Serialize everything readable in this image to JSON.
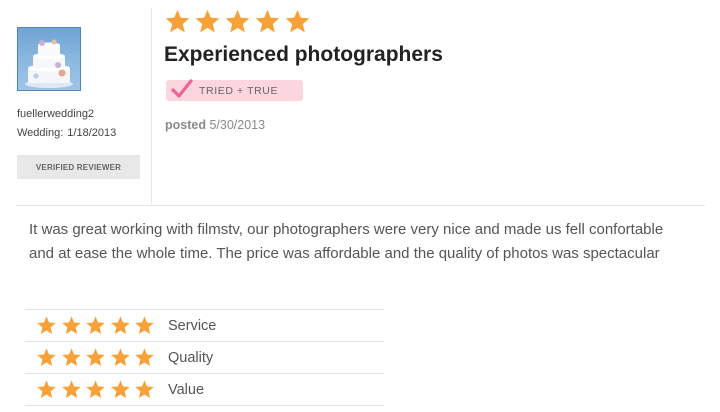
{
  "reviewer": {
    "username": "fuellerwedding2",
    "wedding_label": "Wedding:",
    "wedding_date": "1/18/2013",
    "verified_label": "VERIFIED REVIEWER",
    "avatar_icon": "wedding-cake-icon"
  },
  "review": {
    "overall_rating": 5,
    "max_rating": 5,
    "title": "Experienced photographers",
    "badge_label": "TRIED + TRUE",
    "posted_label": "posted",
    "posted_date": "5/30/2013",
    "body": "It was great working with filmstv, our photographers were very nice and made us fell confortable and at ease the whole time. The price was affordable and the quality of photos was spectacular"
  },
  "ratings": [
    {
      "label": "Service",
      "stars": 5
    },
    {
      "label": "Quality",
      "stars": 5
    },
    {
      "label": "Value",
      "stars": 5
    }
  ],
  "colors": {
    "star": "#f7a139",
    "badge_bg": "#fcd6df",
    "badge_check": "#f06292",
    "verified_bg": "#e8e8e8"
  }
}
